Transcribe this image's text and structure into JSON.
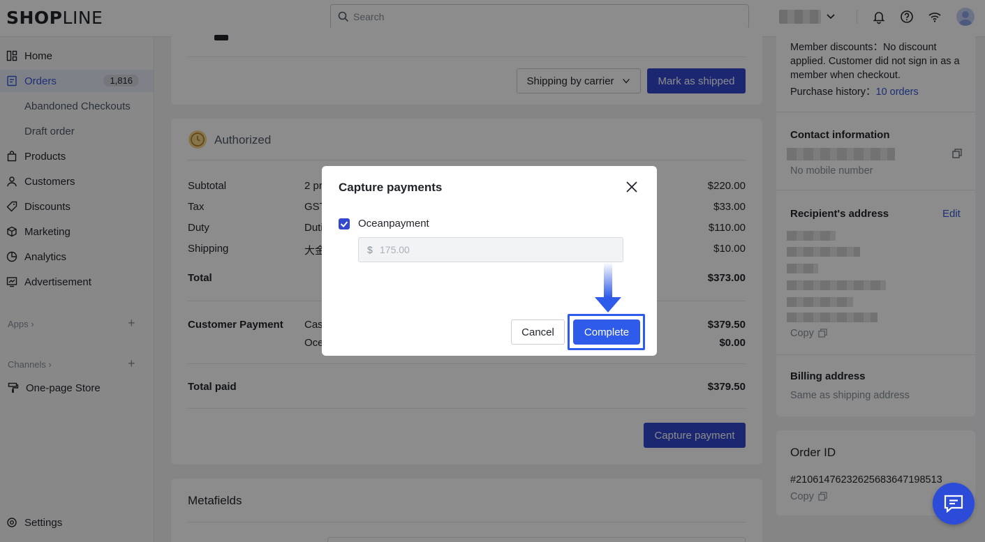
{
  "brand": {
    "logo_bold": "SHOP",
    "logo_light": "LINE"
  },
  "search": {
    "placeholder": "Search"
  },
  "sidebar": {
    "items": [
      {
        "label": "Home"
      },
      {
        "label": "Orders",
        "badge": "1,816"
      },
      {
        "label": "Abandoned Checkouts"
      },
      {
        "label": "Draft order"
      },
      {
        "label": "Products"
      },
      {
        "label": "Customers"
      },
      {
        "label": "Discounts"
      },
      {
        "label": "Marketing"
      },
      {
        "label": "Analytics"
      },
      {
        "label": "Advertisement"
      }
    ],
    "apps_label": "Apps",
    "channels_label": "Channels",
    "store_label": "One-page Store",
    "settings_label": "Settings"
  },
  "fulfillment": {
    "shipping_select": "Shipping by carrier",
    "mark_shipped": "Mark as shipped"
  },
  "payment": {
    "status": "Authorized",
    "rows": [
      {
        "label": "Subtotal",
        "desc": "2 pr",
        "value": "$220.00"
      },
      {
        "label": "Tax",
        "desc": "GST",
        "value": "$33.00"
      },
      {
        "label": "Duty",
        "desc": "Duti",
        "value": "$110.00"
      },
      {
        "label": "Shipping",
        "desc": "大金",
        "value": "$10.00"
      }
    ],
    "total_label": "Total",
    "total_value": "$373.00",
    "customer_payment_label": "Customer Payment",
    "customer_payment_desc1": "Cas",
    "customer_payment_desc2": "Oce",
    "customer_payment_value1": "$379.50",
    "customer_payment_value2": "$0.00",
    "total_paid_label": "Total paid",
    "total_paid_value": "$379.50",
    "capture_button": "Capture payment"
  },
  "metafields": {
    "title": "Metafields"
  },
  "customer": {
    "member_discounts": "Member discounts：No discount applied. Customer did not sign in as a member when checkout.",
    "purchase_history_label": "Purchase history：",
    "purchase_history_link": "10 orders",
    "contact_title": "Contact information",
    "no_mobile": "No mobile number",
    "recipient_title": "Recipient's address",
    "edit_label": "Edit",
    "copy_label": "Copy",
    "billing_title": "Billing address",
    "billing_text": "Same as shipping address"
  },
  "order_id": {
    "title": "Order ID",
    "value": "#21061476232625683647198513",
    "copy_label": "Copy"
  },
  "modal": {
    "title": "Capture payments",
    "provider": "Oceanpayment",
    "currency": "$",
    "amount_placeholder": "175.00",
    "cancel": "Cancel",
    "complete": "Complete"
  },
  "colors": {
    "accent": "#3347cf",
    "highlight": "#2f5bea",
    "overlay": "rgba(0,0,0,0.45)"
  }
}
